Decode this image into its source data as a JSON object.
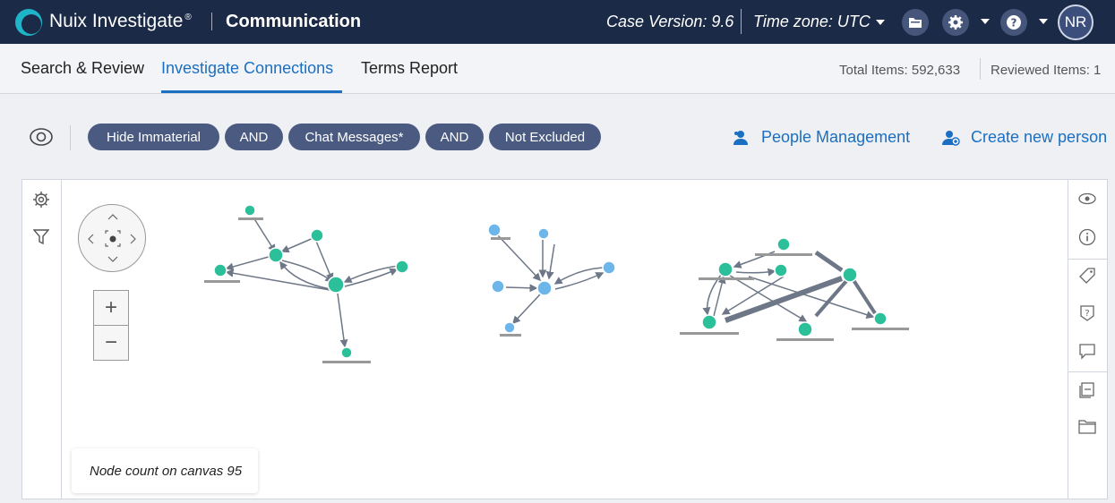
{
  "header": {
    "brand": "Nuix Investigate",
    "brand_mark": "®",
    "app_title": "Communication",
    "case_version": "Case Version: 9.6",
    "time_zone": "Time zone: UTC",
    "user_initials": "NR"
  },
  "tabs": [
    {
      "label": "Search & Review",
      "active": false
    },
    {
      "label": "Investigate Connections",
      "active": true
    },
    {
      "label": "Terms Report",
      "active": false
    }
  ],
  "stats": {
    "total_items": "Total Items: 592,633",
    "reviewed_items": "Reviewed Items: 1"
  },
  "filters": {
    "chips": [
      "Hide Immaterial",
      "AND",
      "Chat Messages*",
      "AND",
      "Not Excluded"
    ],
    "people_management": "People Management",
    "create_new_person": "Create new person"
  },
  "canvas": {
    "node_count": "Node count on canvas 95"
  },
  "colors": {
    "header_bg": "#1b2a47",
    "accent_blue": "#1b6fc2",
    "chip_bg": "#4a5a80",
    "node_green": "#2bbf9a",
    "node_blue": "#6cb6ea",
    "edge_gray": "#6e7787"
  }
}
